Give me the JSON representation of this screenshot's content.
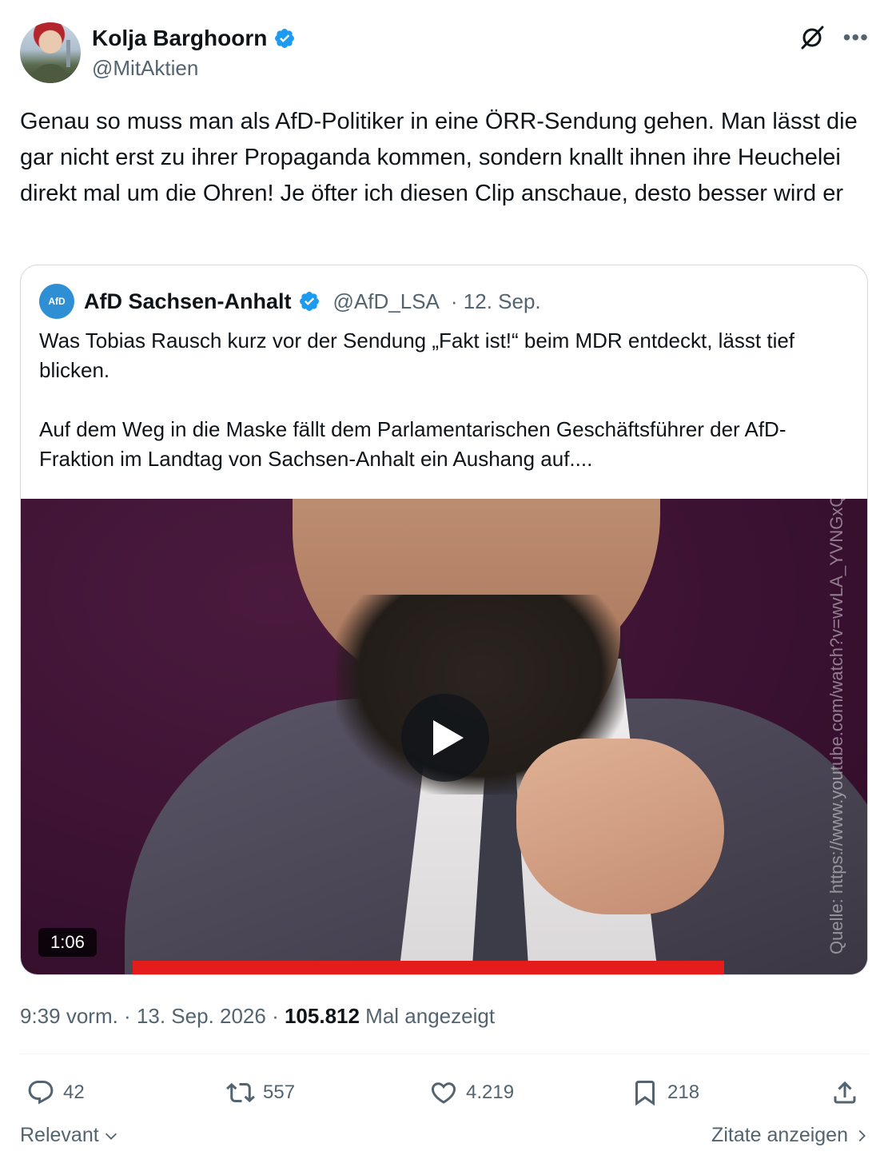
{
  "author": {
    "display_name": "Kolja Barghoorn",
    "handle": "@MitAktien"
  },
  "tweet": {
    "text": "Genau so muss man als AfD-Politiker in eine ÖRR-Sendung gehen. Man lässt die gar nicht erst zu ihrer Propaganda kommen, sondern knallt ihnen ihre Heuchelei direkt mal um die Ohren! Je öfter ich diesen Clip anschaue, desto besser wird er"
  },
  "quote": {
    "avatar_text": "AfD",
    "display_name": "AfD Sachsen-Anhalt",
    "handle": "@AfD_LSA",
    "date": "· 12. Sep.",
    "text_p1": "Was Tobias Rausch kurz vor der Sendung „Fakt ist!“ beim MDR entdeckt, lässt tief blicken.",
    "text_p2": "Auf dem Weg in die Maske fällt dem Parlamentarischen Geschäftsführer der AfD-Fraktion im Landtag von Sachsen-Anhalt ein Aushang auf....",
    "video": {
      "duration": "1:06",
      "watermark": "Quelle: https://www.youtube.com/watch?v=wvLA_YVNGxQ"
    }
  },
  "meta": {
    "time": "9:39 vorm.",
    "sep1": " · ",
    "date": "13. Sep. 2026",
    "sep2": " · ",
    "views": "105.812",
    "views_label": " Mal angezeigt"
  },
  "actions": {
    "replies": "42",
    "reposts": "557",
    "likes": "4.219",
    "bookmarks": "218"
  },
  "footer": {
    "sort_label": "Relevant",
    "quotes_label": "Zitate anzeigen"
  },
  "colors": {
    "verified": "#1d9bf0",
    "text_primary": "#0f1419",
    "text_secondary": "#536471",
    "border": "#cfd9de"
  },
  "icons": [
    "verified-badge-icon",
    "grok-icon",
    "more-icon",
    "play-icon",
    "reply-icon",
    "repost-icon",
    "like-icon",
    "bookmark-icon",
    "share-icon",
    "chevron-down-icon",
    "chevron-right-icon"
  ]
}
